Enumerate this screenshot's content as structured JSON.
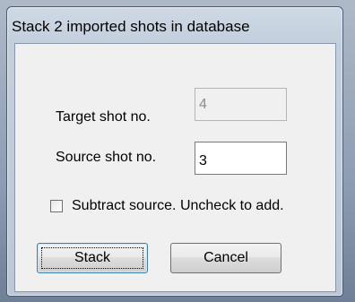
{
  "dialog": {
    "title": "Stack 2 imported shots in database"
  },
  "form": {
    "target_label": "Target shot no.",
    "target_value": "4",
    "source_label": "Source shot no.",
    "source_value": "3",
    "subtract_label": "Subtract source. Uncheck to add.",
    "subtract_checked": false
  },
  "buttons": {
    "stack_label": "Stack",
    "cancel_label": "Cancel"
  }
}
